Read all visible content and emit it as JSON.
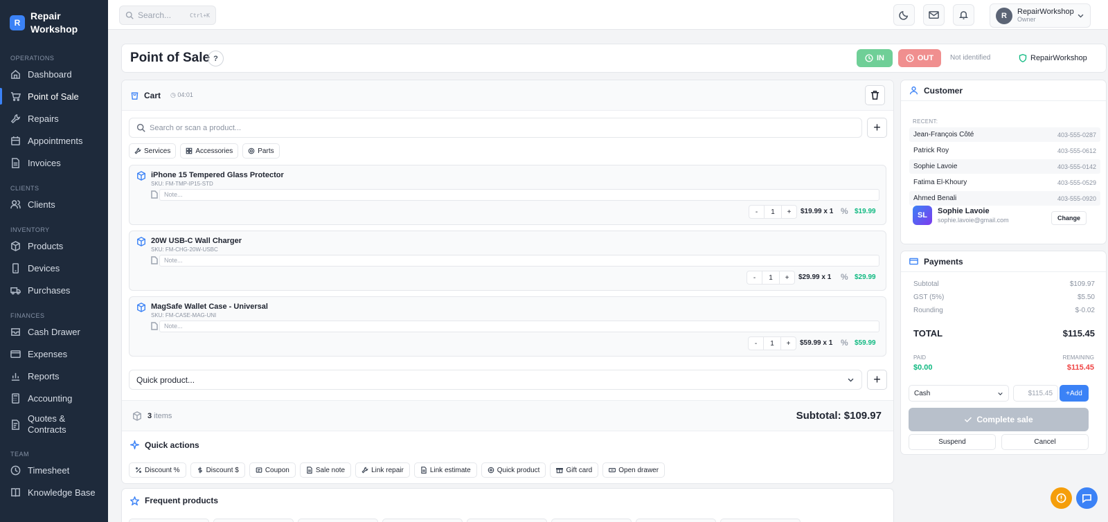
{
  "brand": {
    "logo": "R",
    "name": "Repair Workshop"
  },
  "sidebar": {
    "sections": [
      {
        "label": "OPERATIONS",
        "items": [
          {
            "label": "Dashboard",
            "icon": "home-icon"
          },
          {
            "label": "Point of Sale",
            "icon": "cart-icon"
          },
          {
            "label": "Repairs",
            "icon": "wrench-icon"
          },
          {
            "label": "Appointments",
            "icon": "calendar-icon"
          },
          {
            "label": "Invoices",
            "icon": "file-icon"
          }
        ]
      },
      {
        "label": "CLIENTS",
        "items": [
          {
            "label": "Clients",
            "icon": "users-icon"
          }
        ]
      },
      {
        "label": "INVENTORY",
        "items": [
          {
            "label": "Products",
            "icon": "box-icon"
          },
          {
            "label": "Devices",
            "icon": "phone-icon"
          },
          {
            "label": "Purchases",
            "icon": "truck-icon"
          }
        ]
      },
      {
        "label": "FINANCES",
        "items": [
          {
            "label": "Cash Drawer",
            "icon": "drawer-icon"
          },
          {
            "label": "Expenses",
            "icon": "card-icon"
          },
          {
            "label": "Reports",
            "icon": "chart-icon"
          },
          {
            "label": "Accounting",
            "icon": "calculator-icon"
          },
          {
            "label": "Quotes & Contracts",
            "icon": "contract-icon"
          }
        ]
      },
      {
        "label": "TEAM",
        "items": [
          {
            "label": "Timesheet",
            "icon": "clock-icon"
          },
          {
            "label": "Knowledge Base",
            "icon": "book-icon"
          }
        ]
      }
    ]
  },
  "topbar": {
    "search_placeholder": "Search...",
    "search_shortcut": "Ctrl+K",
    "user_initial": "R",
    "user_name": "RepairWorkshop",
    "user_role": "Owner"
  },
  "page": {
    "title": "Point of Sale",
    "help": "?",
    "in_label": "IN",
    "out_label": "OUT",
    "identified": "Not identified",
    "shop": "RepairWorkshop"
  },
  "cart": {
    "title": "Cart",
    "timer": "04:01",
    "search_placeholder": "Search or scan a product...",
    "chips": [
      "Services",
      "Accessories",
      "Parts"
    ],
    "items": [
      {
        "name": "iPhone 15 Tempered Glass Protector",
        "sku": "SKU: FM-TMP-IP15-STD",
        "note": "Note...",
        "qty": "1",
        "unit": "$19.99 x 1",
        "pct": "%",
        "total": "$19.99"
      },
      {
        "name": "20W USB-C Wall Charger",
        "sku": "SKU: FM-CHG-20W-USBC",
        "note": "Note...",
        "qty": "1",
        "unit": "$29.99 x 1",
        "pct": "%",
        "total": "$29.99"
      },
      {
        "name": "MagSafe Wallet Case - Universal",
        "sku": "SKU: FM-CASE-MAG-UNI",
        "note": "Note...",
        "qty": "1",
        "unit": "$59.99 x 1",
        "pct": "%",
        "total": "$59.99"
      }
    ],
    "quick_placeholder": "Quick product...",
    "count": "3",
    "count_label": "items",
    "subtotal": "Subtotal: $109.97"
  },
  "quick_actions": {
    "title": "Quick actions",
    "items": [
      "Discount %",
      "Discount $",
      "Coupon",
      "Sale note",
      "Link repair",
      "Link estimate",
      "Quick product",
      "Gift card",
      "Open drawer"
    ]
  },
  "frequent": {
    "title": "Frequent products"
  },
  "customer": {
    "title": "Customer",
    "recent_label": "RECENT:",
    "recent": [
      {
        "name": "Jean-François Côté",
        "phone": "403-555-0287"
      },
      {
        "name": "Patrick Roy",
        "phone": "403-555-0612"
      },
      {
        "name": "Sophie Lavoie",
        "phone": "403-555-0142"
      },
      {
        "name": "Fatima El-Khoury",
        "phone": "403-555-0529"
      },
      {
        "name": "Ahmed Benali",
        "phone": "403-555-0920"
      }
    ],
    "selected": {
      "initials": "SL",
      "name": "Sophie Lavoie",
      "email": "sophie.lavoie@gmail.com",
      "change": "Change"
    }
  },
  "payments": {
    "title": "Payments",
    "rows": [
      {
        "label": "Subtotal",
        "value": "$109.97"
      },
      {
        "label": "GST (5%)",
        "value": "$5.50"
      },
      {
        "label": "Rounding",
        "value": "$-0.02"
      }
    ],
    "total_label": "TOTAL",
    "total": "$115.45",
    "paid_label": "PAID",
    "paid": "$0.00",
    "remaining_label": "REMAINING",
    "remaining": "$115.45",
    "method": "Cash",
    "amount_placeholder": "$115.45",
    "add": "+Add",
    "complete": "Complete sale",
    "suspend": "Suspend",
    "cancel": "Cancel"
  },
  "colors": {
    "accent": "#3b82f6",
    "in": "#6fcf97",
    "out": "#f08f8f",
    "success": "#10b981",
    "danger": "#ef4444",
    "sidebar": "#1e2a3b"
  }
}
